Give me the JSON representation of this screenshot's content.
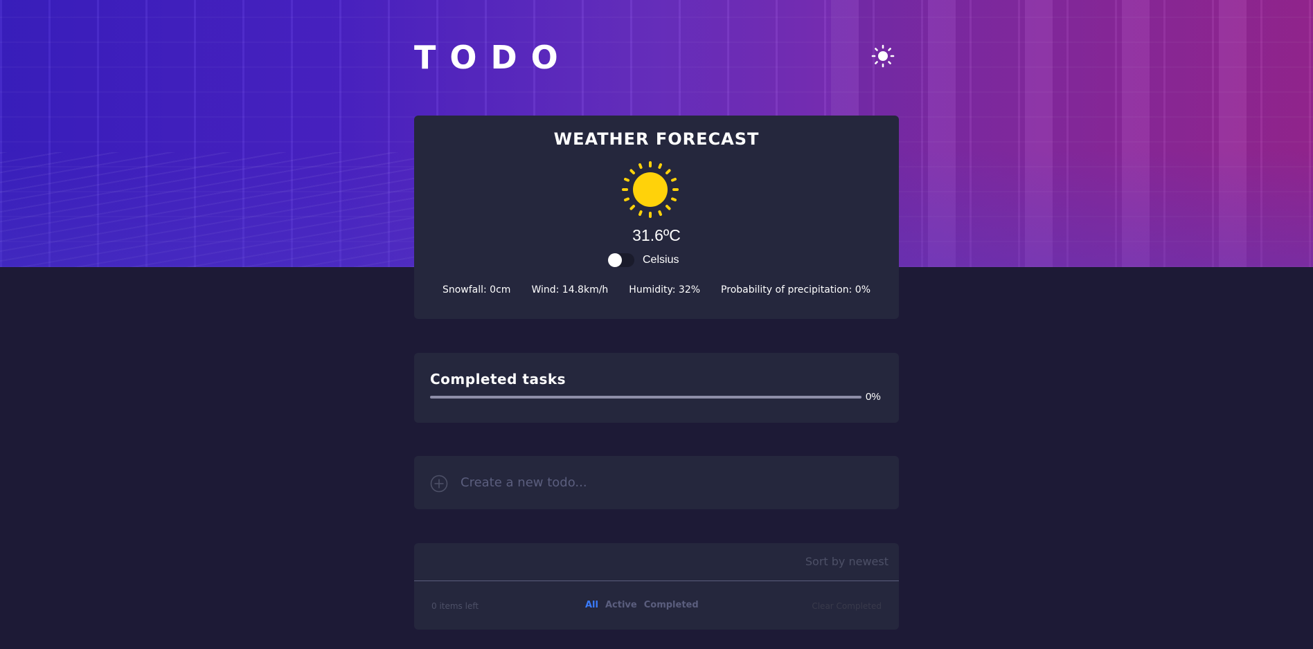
{
  "app": {
    "title": "TODO"
  },
  "theme": {
    "icon": "sun-icon"
  },
  "weather": {
    "title": "WEATHER FORECAST",
    "icon": "sun-icon",
    "temperature": "31.6ºC",
    "unit_label": "Celsius",
    "unit_toggle_on": false,
    "stats": {
      "snowfall": "Snowfall: 0cm",
      "wind": "Wind: 14.8km/h",
      "humidity": "Humidity: 32%",
      "precipitation": "Probability of precipitation: 0%"
    }
  },
  "progress": {
    "title": "Completed tasks",
    "value": 0,
    "percent_label": "0%"
  },
  "new_todo": {
    "placeholder": "Create a new todo...",
    "value": "",
    "icon": "plus-circle-icon"
  },
  "list": {
    "sort_label": "Sort by newest",
    "items": [],
    "items_left": "0 items left",
    "filters": [
      {
        "label": "All",
        "active": true
      },
      {
        "label": "Active",
        "active": false
      },
      {
        "label": "Completed",
        "active": false
      }
    ],
    "clear_label": "Clear Completed"
  },
  "colors": {
    "accent": "#3a7bfd",
    "card_bg": "#25273d",
    "page_bg": "#1d1a36",
    "sun": "#ffd20a"
  }
}
